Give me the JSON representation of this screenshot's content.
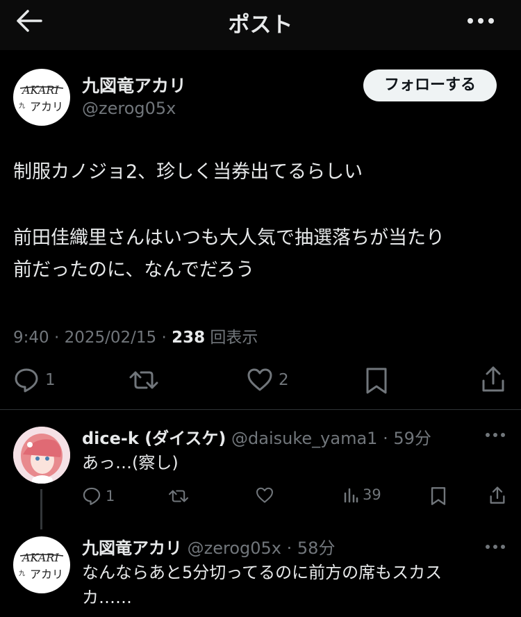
{
  "header": {
    "title": "ポスト"
  },
  "post": {
    "display_name": "九図竜アカリ",
    "handle": "@zerog05x",
    "follow_label": "フォローする",
    "avatar_text": "AKARI アカリ",
    "line1": "制服カノジョ2、珍しく当券出てるらしい",
    "line2": "前田佳織里さんはいつも大人気で抽選落ちが当たり",
    "line3": "前だったのに、なんでだろう",
    "time": "9:40 · 2025/02/15 · ",
    "views_count": "238",
    "views_label": " 回表示",
    "reply_count": "1",
    "like_count": "2"
  },
  "replies": [
    {
      "display_name": "dice-k (ダイスケ)",
      "handle": "@daisuke_yama1",
      "age": " · 59分",
      "text": "あっ…(察し)",
      "reply_count": "1",
      "view_count": "39"
    },
    {
      "display_name": "九図竜アカリ",
      "handle": "@zerog05x",
      "age": " · 58分",
      "text1": "なんならあと5分切ってるのに前方の席もスカス",
      "text2": "カ……"
    }
  ]
}
